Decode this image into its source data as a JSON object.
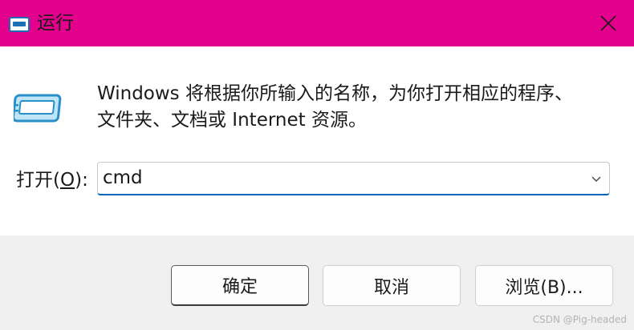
{
  "window": {
    "title": "运行",
    "title_bar_color": "#e3008c",
    "app_icon": "run-dialog-icon",
    "close_icon": "close-icon"
  },
  "main": {
    "icon": "run-dialog-icon",
    "description_line1": "Windows 将根据你所输入的名称，为你打开相应的程序、",
    "description_line2": "文件夹、文档或 Internet 资源。",
    "open_label_prefix": "打开(",
    "open_label_key": "O",
    "open_label_suffix": "):",
    "open_value": "cmd",
    "dropdown_icon": "chevron-down-icon",
    "focus_color": "#0067c0"
  },
  "footer": {
    "ok_label": "确定",
    "cancel_label": "取消",
    "browse_label": "浏览(B)..."
  },
  "watermark": "CSDN @Pig-headed"
}
